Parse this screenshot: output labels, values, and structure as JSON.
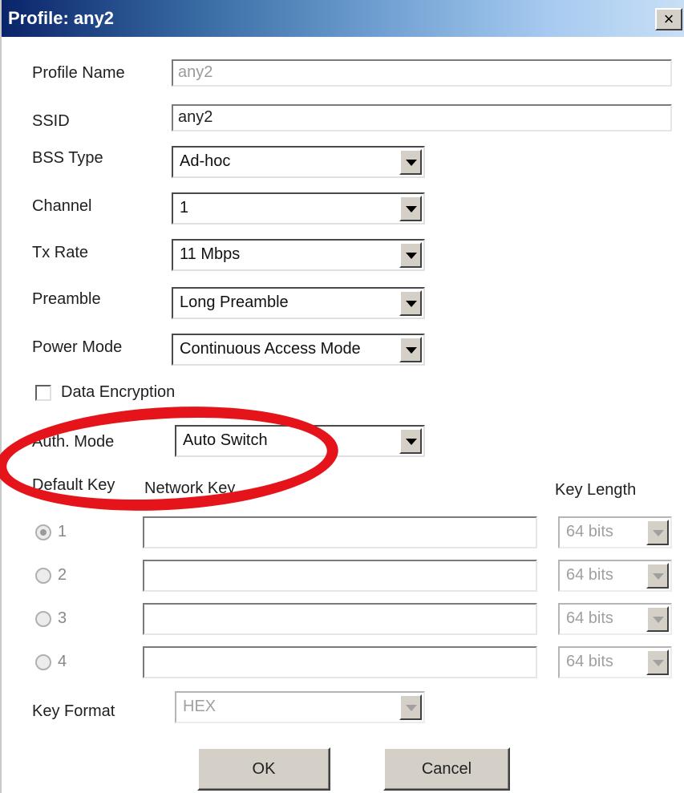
{
  "window": {
    "title": "Profile: any2",
    "close_label": "×"
  },
  "fields": {
    "profile_name": {
      "label": "Profile Name",
      "value": "any2"
    },
    "ssid": {
      "label": "SSID",
      "value": "any2"
    },
    "bss_type": {
      "label": "BSS Type",
      "value": "Ad-hoc"
    },
    "channel": {
      "label": "Channel",
      "value": "1"
    },
    "tx_rate": {
      "label": "Tx Rate",
      "value": "11 Mbps"
    },
    "preamble": {
      "label": "Preamble",
      "value": "Long Preamble"
    },
    "power_mode": {
      "label": "Power Mode",
      "value": "Continuous Access Mode"
    }
  },
  "encryption": {
    "checkbox_label": "Data Encryption",
    "checked": false,
    "auth_mode_label": "Auth. Mode",
    "auth_mode_value": "Auto Switch"
  },
  "keys": {
    "default_key_header": "Default Key",
    "network_key_header": "Network Key",
    "key_length_header": "Key Length",
    "rows": [
      {
        "index": "1",
        "value": "",
        "length": "64 bits",
        "selected": true
      },
      {
        "index": "2",
        "value": "",
        "length": "64 bits",
        "selected": false
      },
      {
        "index": "3",
        "value": "",
        "length": "64 bits",
        "selected": false
      },
      {
        "index": "4",
        "value": "",
        "length": "64 bits",
        "selected": false
      }
    ],
    "format_label": "Key Format",
    "format_value": "HEX"
  },
  "buttons": {
    "ok": "OK",
    "cancel": "Cancel"
  },
  "annotation": {
    "color": "#e4141a",
    "shape": "red-oval-highlight"
  }
}
